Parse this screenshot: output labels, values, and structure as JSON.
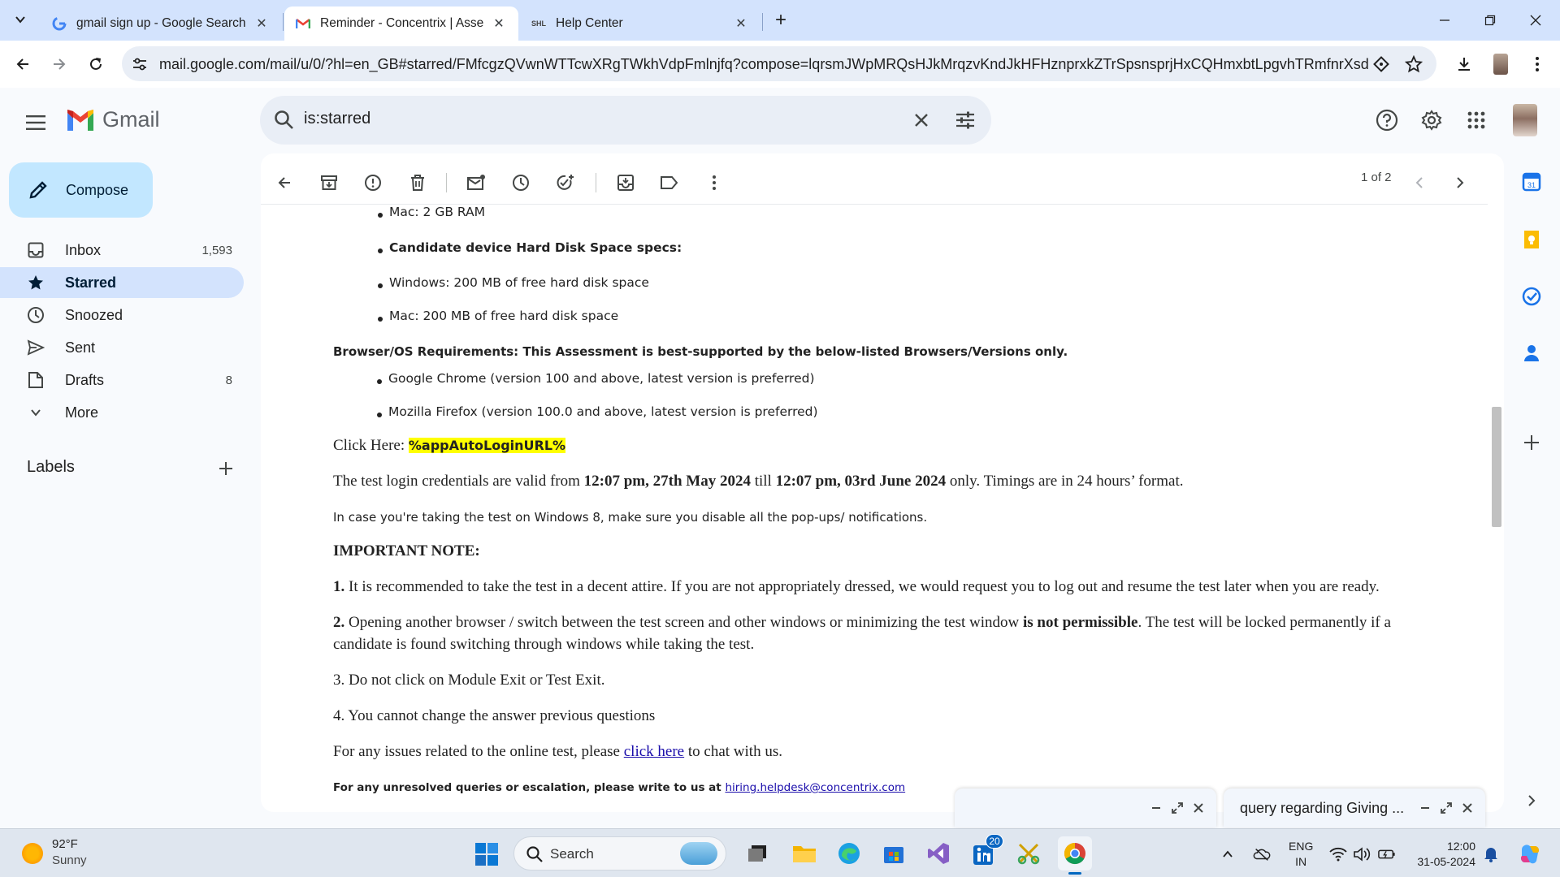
{
  "browser": {
    "tabs": [
      {
        "title": "gmail sign up - Google Search",
        "favicon": "google-g-icon"
      },
      {
        "title": "Reminder - Concentrix | Assessment",
        "favicon": "gmail-icon"
      },
      {
        "title": "Help Center",
        "favicon": "SHL"
      }
    ],
    "url": "mail.google.com/mail/u/0/?hl=en_GB#starred/FMfcgzQVwnWTTcwXRgTWkhVdpFmlnjfq?compose=lqrsmJWpMRQsHJkMrqzvKndJkHFHznprxkZTrSpsnsprjHxCQHmxbtLpgvhTRmfnrXsdPXNXQ..."
  },
  "gmail": {
    "logo_text": "Gmail",
    "search_query": "is:starred",
    "compose_label": "Compose",
    "nav": [
      {
        "label": "Inbox",
        "count": "1,593",
        "icon": "inbox-icon"
      },
      {
        "label": "Starred",
        "count": "",
        "icon": "star-icon"
      },
      {
        "label": "Snoozed",
        "count": "",
        "icon": "clock-icon"
      },
      {
        "label": "Sent",
        "count": "",
        "icon": "send-icon"
      },
      {
        "label": "Drafts",
        "count": "8",
        "icon": "draft-icon"
      },
      {
        "label": "More",
        "count": "",
        "icon": "chevron-down-icon"
      }
    ],
    "labels_header": "Labels",
    "pager": "1 of 2"
  },
  "email": {
    "bullet_mac_ram": "Mac: 2 GB RAM",
    "bullet_disk_header": "Candidate device Hard Disk Space specs:",
    "bullet_win_disk": "Windows: 200 MB of free hard disk space",
    "bullet_mac_disk": "Mac: 200 MB of free hard disk space",
    "browser_req": "Browser/OS Requirements: This Assessment is best-supported by the below-listed Browsers/Versions only.",
    "bullet_chrome": "Google Chrome (version 100 and above, latest version is preferred)",
    "bullet_firefox": "Mozilla Firefox (version 100.0 and above, latest version is preferred)",
    "click_here_prefix": "Click Here: ",
    "click_here_link": "%appAutoLoginURL%",
    "valid_1": "The test login credentials are valid from ",
    "valid_2": "12:07 pm, 27th May 2024",
    "valid_3": " till ",
    "valid_4": "12:07 pm, 03rd June 2024",
    "valid_5": " only. Timings are in 24 hours’ format.",
    "win8_note": "In case you're taking the test on Windows 8, make sure you disable all the pop-ups/ notifications.",
    "important_note": "IMPORTANT NOTE:",
    "note1_num": "1.",
    "note1_text": " It is recommended to take the test in a decent attire. If you are not appropriately dressed, we would request you to log out and resume the test later when you are ready.",
    "note2_num": "2.",
    "note2_text_a": " Opening another browser / switch between the test screen and other windows or minimizing the test window ",
    "note2_bold": "is not permissible",
    "note2_text_b": ". The test will be locked permanently if a",
    "note2_line2": "candidate is found switching through windows while taking the test.",
    "note3": "3. Do not click on Module Exit or Test Exit.",
    "note4": "4. You cannot change the answer previous questions",
    "issues_a": "For any issues related to the online test, please ",
    "issues_link": "click here",
    "issues_b": " to chat with us.",
    "unresolved": "For any unresolved queries or escalation, please write to us at ",
    "email_link": "hiring.helpdesk@concentrix.com"
  },
  "compose_windows": [
    {
      "title": ""
    },
    {
      "title": "query regarding Giving ..."
    }
  ],
  "taskbar": {
    "temp": "92°F",
    "weather": "Sunny",
    "search_label": "Search",
    "linkedin_badge": "20",
    "lang_1": "ENG",
    "lang_2": "IN",
    "time": "12:00",
    "date": "31-05-2024"
  }
}
